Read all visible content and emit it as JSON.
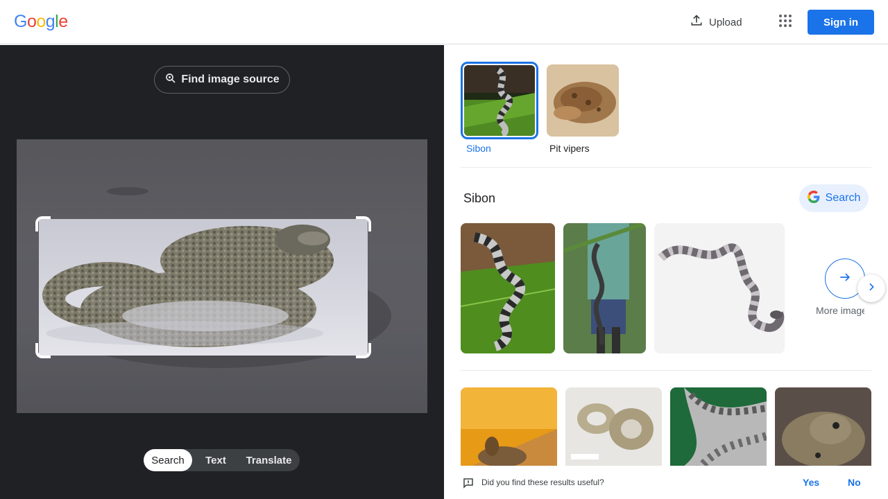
{
  "header": {
    "logo_text": "Google",
    "upload_label": "Upload",
    "signin_label": "Sign in",
    "colors": {
      "blue": "#4285F4",
      "red": "#EA4335",
      "yellow": "#FBBC05",
      "green": "#34A853",
      "accent": "#1a73e8"
    }
  },
  "left": {
    "find_source_label": "Find image source",
    "modes": [
      {
        "label": "Search",
        "active": true
      },
      {
        "label": "Text",
        "active": false
      },
      {
        "label": "Translate",
        "active": false
      }
    ]
  },
  "results": {
    "chips": [
      {
        "label": "Sibon",
        "selected": true
      },
      {
        "label": "Pit vipers",
        "selected": false
      }
    ],
    "section_title": "Sibon",
    "search_button_label": "Search",
    "more_images_label": "More images"
  },
  "feedback": {
    "question": "Did you find these results useful?",
    "yes_label": "Yes",
    "no_label": "No"
  }
}
